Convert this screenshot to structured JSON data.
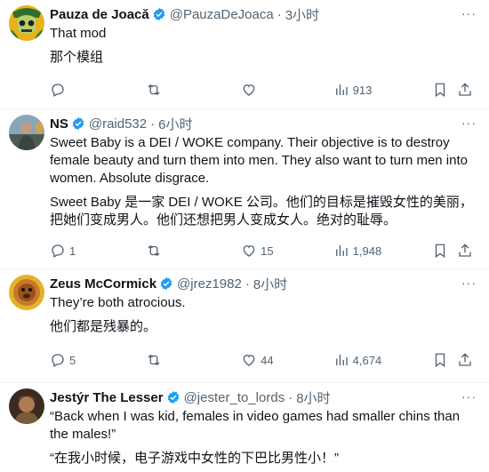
{
  "tweets": [
    {
      "name": "Pauza de Joacă",
      "handle": "@PauzaDeJoaca",
      "time": "3小时",
      "text": [
        "That mod"
      ],
      "translation": [
        "那个模组"
      ],
      "replies": "",
      "retweets": "",
      "likes": "",
      "views": "913",
      "avatar_icon": "skull-avatar"
    },
    {
      "name": "NS",
      "handle": "@raid532",
      "time": "6小时",
      "text": [
        "Sweet Baby is a DEI / WOKE company. Their objective is to destroy female beauty and turn them into men. They also want to turn men into women. Absolute disgrace."
      ],
      "translation": [
        "Sweet Baby 是一家 DEI / WOKE 公司。他们的目标是摧毁女性的美丽，把她们变成男人。他们还想把男人变成女人。绝对的耻辱。"
      ],
      "replies": "1",
      "retweets": "",
      "likes": "15",
      "views": "1,948",
      "avatar_icon": "person-avatar"
    },
    {
      "name": "Zeus McCormick",
      "handle": "@jrez1982",
      "time": "8小时",
      "text": [
        "They’re both atrocious."
      ],
      "translation": [
        "他们都是残暴的。"
      ],
      "replies": "5",
      "retweets": "",
      "likes": "44",
      "views": "4,674",
      "avatar_icon": "dog-avatar"
    },
    {
      "name": "Jestýr The Lesser",
      "handle": "@jester_to_lords",
      "time": "8小时",
      "text": [
        "“Back when I was kid, females in video games had smaller chins than the males!”"
      ],
      "translation": [
        "“在我小时候，电子游戏中女性的下巴比男性小！”"
      ],
      "replies": "",
      "retweets": "",
      "likes": "",
      "views": "",
      "avatar_icon": "warrior-avatar"
    }
  ],
  "separator": "·",
  "more_label": "···",
  "colors": {
    "verified": "#1d9bf0",
    "muted": "#536471",
    "text": "#0f1419"
  }
}
